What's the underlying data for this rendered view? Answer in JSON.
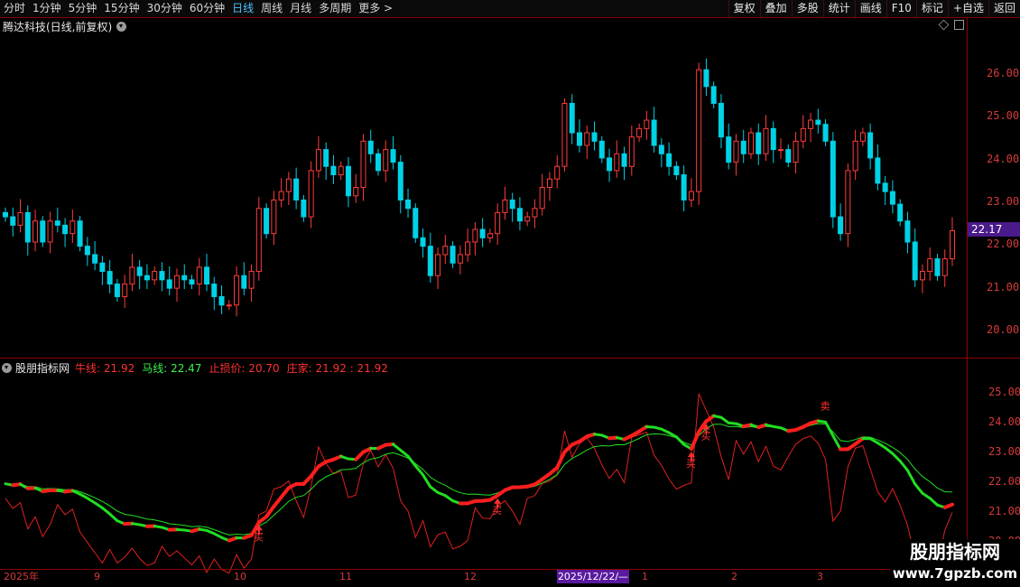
{
  "toolbar": {
    "periods": [
      "分时",
      "1分钟",
      "5分钟",
      "15分钟",
      "30分钟",
      "60分钟",
      "日线",
      "周线",
      "月线",
      "多周期",
      "更多 >"
    ],
    "active_index": 6,
    "buttons": [
      "复权",
      "叠加",
      "多股",
      "统计",
      "画线",
      "F10",
      "标记",
      "+自选",
      "返回"
    ]
  },
  "stock": {
    "title": "腾达科技(日线,前复权)"
  },
  "price_axis": {
    "labels": [
      "26.00",
      "25.00",
      "24.00",
      "23.00",
      "22.00",
      "21.00",
      "20.00"
    ]
  },
  "current_price": "22.17",
  "indicator": {
    "name": "股朋指标网",
    "legend": [
      {
        "text": "牛线: 21.92",
        "color": "red"
      },
      {
        "text": "马线: 22.47",
        "color": "green"
      },
      {
        "text": "止损价: 20.70",
        "color": "red"
      },
      {
        "text": "庄家: 21.92 : 21.92",
        "color": "red"
      }
    ],
    "axis_labels": [
      "25.00",
      "24.00",
      "23.00",
      "22.00",
      "21.00",
      "20.00"
    ],
    "signals": [
      "买",
      "买",
      "买",
      "买",
      "卖"
    ]
  },
  "date_axis": {
    "ticks": [
      "2025年",
      "9",
      "10",
      "11",
      "12",
      "1",
      "2",
      "3"
    ],
    "highlight": "2025/12/22/—"
  },
  "watermark": {
    "line1": "股朋指标网",
    "line2": "www.7gpzb.com"
  },
  "colors": {
    "up": "#ff3c3c",
    "down": "#00d2e6",
    "bull": "#ff2020",
    "horse": "#20e020",
    "accent": "#4fc3ff"
  },
  "chart_data": {
    "type": "candlestick",
    "start_price": 22.6,
    "price_range": [
      19.6,
      26.8
    ],
    "indicator_range": [
      19.9,
      25.9
    ],
    "candles_close": [
      22.5,
      22.3,
      22.6,
      21.9,
      22.4,
      21.9,
      22.4,
      22.3,
      22.1,
      22.4,
      21.8,
      21.6,
      21.4,
      21.2,
      20.9,
      20.6,
      20.9,
      21.3,
      21.1,
      21.0,
      21.2,
      21.0,
      20.8,
      21.1,
      21.0,
      20.9,
      21.3,
      20.9,
      20.6,
      20.4,
      20.4,
      21.1,
      20.8,
      21.2,
      22.7,
      22.1,
      22.9,
      23.1,
      23.4,
      22.9,
      22.5,
      23.6,
      24.1,
      23.7,
      23.5,
      23.7,
      23.0,
      23.2,
      24.3,
      24.0,
      23.6,
      24.1,
      23.8,
      22.9,
      22.7,
      22.0,
      21.8,
      21.1,
      21.6,
      21.8,
      21.4,
      21.6,
      21.9,
      22.2,
      22.0,
      22.1,
      22.6,
      22.9,
      22.7,
      22.4,
      22.5,
      22.7,
      23.2,
      23.4,
      23.7,
      25.2,
      24.5,
      24.2,
      24.5,
      24.3,
      23.9,
      23.6,
      24.0,
      23.7,
      24.4,
      24.6,
      24.8,
      24.2,
      24.0,
      23.7,
      23.5,
      22.9,
      23.1,
      26.0,
      25.6,
      25.2,
      24.4,
      23.8,
      24.3,
      24.0,
      24.5,
      24.0,
      24.6,
      24.1,
      24.1,
      23.8,
      24.3,
      24.6,
      24.8,
      24.7,
      24.3,
      22.5,
      22.1,
      23.6,
      24.3,
      24.5,
      23.9,
      23.3,
      23.1,
      22.8,
      22.4,
      21.9,
      21.0,
      21.2,
      21.5,
      21.1,
      21.5,
      22.17
    ],
    "series": [
      {
        "name": "牛线",
        "last": 21.92
      },
      {
        "name": "马线",
        "last": 22.47
      },
      {
        "name": "止损价",
        "last": 20.7
      },
      {
        "name": "庄家",
        "last": 21.92
      }
    ]
  }
}
